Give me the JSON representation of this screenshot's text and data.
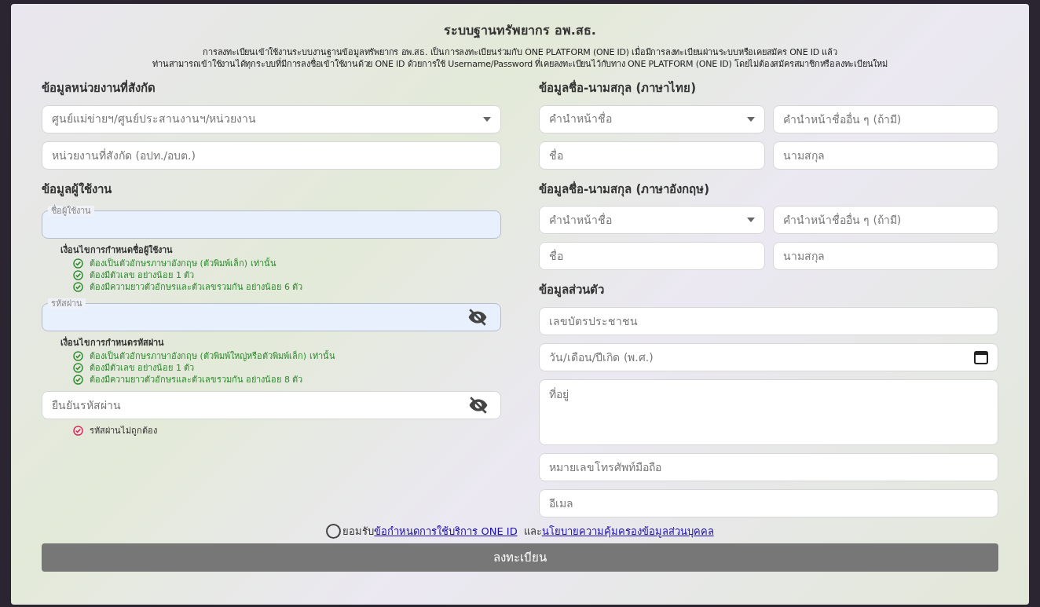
{
  "title": "ระบบฐานทรัพยากร อพ.สธ.",
  "intro": [
    "การลงทะเบียนเข้าใช้งานระบบงานฐานข้อมูลทรัพยากร อพ.สธ. เป็นการลงทะเบียนร่วมกับ ONE PLATFORM (ONE ID) เมื่อมีการลงทะเบียนผ่านระบบหรือเคยสมัคร ONE ID แล้ว",
    "ท่านสามารถเข้าใช้งานได้ทุกระบบที่มีการลงชื่อเข้าใช้งานด้วย ONE ID ด้วยการใช้ Username/Password ที่เคยลงทะเบียนไว้กับทาง ONE PLATFORM (ONE ID) โดยไม่ต้องสมัครสมาชิกหรือลงทะเบียนใหม่"
  ],
  "left": [
    {
      "kind": "heading",
      "text": "ข้อมูลหน่วยงานที่สังกัด"
    },
    {
      "kind": "fields",
      "fields": [
        {
          "kind": "select",
          "placeholder": "ศูนย์แม่ข่ายฯ/ศูนย์ประสานงานฯ/หน่วยงาน"
        }
      ]
    },
    {
      "kind": "fields",
      "fields": [
        {
          "kind": "text",
          "placeholder": "หน่วยงานที่สังกัด (อปท./อบต.)"
        }
      ]
    },
    {
      "kind": "heading",
      "text": "ข้อมูลผู้ใช้งาน"
    },
    {
      "kind": "fields",
      "fields": [
        {
          "kind": "floating",
          "label": "ชื่อผู้ใช้งาน"
        }
      ]
    },
    {
      "kind": "rules",
      "heading": "เงื่อนไขการกำหนดชื่อผู้ใช้งาน",
      "items": [
        {
          "text": "ต้องเป็นตัวอักษรภาษาอังกฤษ (ตัวพิมพ์เล็ก) เท่านั้น",
          "met": true
        },
        {
          "text": "ต้องมีตัวเลข อย่างน้อย 1 ตัว",
          "met": true
        },
        {
          "text": "ต้องมีความยาวตัวอักษรและตัวเลขรวมกัน อย่างน้อย 6 ตัว",
          "met": true
        }
      ]
    },
    {
      "kind": "fields",
      "fields": [
        {
          "kind": "floating-password",
          "label": "รหัสผ่าน"
        }
      ]
    },
    {
      "kind": "rules",
      "heading": "เงื่อนไขการกำหนดรหัสผ่าน",
      "items": [
        {
          "text": "ต้องเป็นตัวอักษรภาษาอังกฤษ (ตัวพิมพ์ใหญ่หรือตัวพิมพ์เล็ก) เท่านั้น",
          "met": true
        },
        {
          "text": "ต้องมีตัวเลข อย่างน้อย 1 ตัว",
          "met": true
        },
        {
          "text": "ต้องมีความยาวตัวอักษรและตัวเลขรวมกัน อย่างน้อย 8 ตัว",
          "met": true
        }
      ]
    },
    {
      "kind": "fields",
      "fields": [
        {
          "kind": "password",
          "placeholder": "ยืนยันรหัสผ่าน"
        }
      ]
    },
    {
      "kind": "rules",
      "items": [
        {
          "text": "รหัสผ่านไม่ถูกต้อง",
          "met": false
        }
      ]
    }
  ],
  "right": [
    {
      "kind": "heading",
      "text": "ข้อมูลชื่อ-นามสกุล (ภาษาไทย)"
    },
    {
      "kind": "fields",
      "fields": [
        {
          "kind": "select",
          "placeholder": "คำนำหน้าชื่อ"
        },
        {
          "kind": "text",
          "placeholder": "คำนำหน้าชื่ออื่น ๆ (ถ้ามี)"
        }
      ]
    },
    {
      "kind": "fields",
      "fields": [
        {
          "kind": "text",
          "placeholder": "ชื่อ"
        },
        {
          "kind": "text",
          "placeholder": "นามสกุล"
        }
      ]
    },
    {
      "kind": "heading",
      "text": "ข้อมูลชื่อ-นามสกุล (ภาษาอังกฤษ)"
    },
    {
      "kind": "fields",
      "fields": [
        {
          "kind": "select",
          "placeholder": "คำนำหน้าชื่อ"
        },
        {
          "kind": "text",
          "placeholder": "คำนำหน้าชื่ออื่น ๆ (ถ้ามี)"
        }
      ]
    },
    {
      "kind": "fields",
      "fields": [
        {
          "kind": "text",
          "placeholder": "ชื่อ"
        },
        {
          "kind": "text",
          "placeholder": "นามสกุล"
        }
      ]
    },
    {
      "kind": "heading",
      "text": "ข้อมูลส่วนตัว"
    },
    {
      "kind": "fields",
      "fields": [
        {
          "kind": "text",
          "placeholder": "เลขบัตรประชาชน"
        }
      ]
    },
    {
      "kind": "fields",
      "fields": [
        {
          "kind": "date",
          "placeholder": "วัน/เดือน/ปีเกิด (พ.ศ.)"
        }
      ]
    },
    {
      "kind": "fields",
      "fields": [
        {
          "kind": "textarea",
          "placeholder": "ที่อยู่"
        }
      ]
    },
    {
      "kind": "fields",
      "fields": [
        {
          "kind": "text",
          "placeholder": "หมายเลขโทรศัพท์มือถือ"
        }
      ]
    },
    {
      "kind": "fields",
      "fields": [
        {
          "kind": "text",
          "placeholder": "อีเมล"
        }
      ]
    }
  ],
  "consent": {
    "checked": false,
    "prefix": "ยอมรับ",
    "link_1": "ข้อกำหนดการใช้บริการ ONE ID",
    "middle": "และ",
    "link_2": "นโยบายความคุ้มครองข้อมูลส่วนบุคคล"
  },
  "submit": "ลงทะเบียน"
}
